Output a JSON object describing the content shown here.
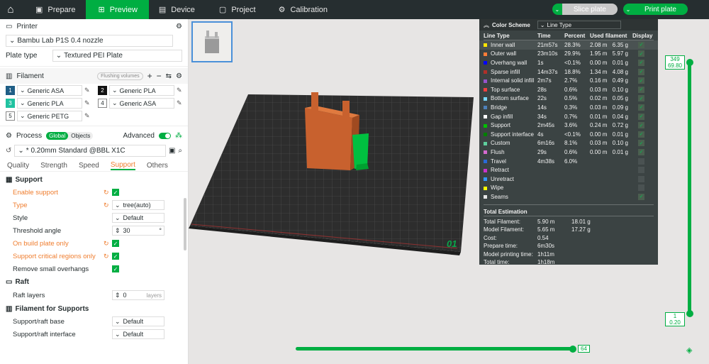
{
  "topbar": {
    "tabs": [
      {
        "label": "Prepare",
        "icon": "prepare-icon",
        "active": false
      },
      {
        "label": "Preview",
        "icon": "preview-icon",
        "active": true
      },
      {
        "label": "Device",
        "icon": "device-icon",
        "active": false
      },
      {
        "label": "Project",
        "icon": "project-icon",
        "active": false
      },
      {
        "label": "Calibration",
        "icon": "calibration-icon",
        "active": false
      }
    ],
    "slice_label": "Slice plate",
    "print_label": "Print plate"
  },
  "printer": {
    "section_title": "Printer",
    "printer_name": "Bambu Lab P1S 0.4 nozzle",
    "plate_type_label": "Plate type",
    "plate_type_value": "Textured PEI Plate"
  },
  "filament": {
    "section_title": "Filament",
    "flushing_label": "Flushing volumes",
    "items": [
      {
        "num": "1",
        "name": "Generic ASA",
        "color": "#1f5e86",
        "text": "#fff"
      },
      {
        "num": "2",
        "name": "Generic PLA",
        "color": "#111111",
        "text": "#fff"
      },
      {
        "num": "3",
        "name": "Generic PLA",
        "color": "#20c2a0",
        "text": "#fff"
      },
      {
        "num": "4",
        "name": "Generic ASA",
        "color": "#ffffff",
        "text": "#222"
      },
      {
        "num": "5",
        "name": "Generic PETG",
        "color": "#ffffff",
        "text": "#222"
      }
    ]
  },
  "process": {
    "section_title": "Process",
    "global_label": "Global",
    "objects_label": "Objects",
    "advanced_label": "Advanced",
    "preset": "* 0.20mm Standard @BBL X1C",
    "tabs": [
      "Quality",
      "Strength",
      "Speed",
      "Support",
      "Others"
    ],
    "active_tab": "Support"
  },
  "support": {
    "group_support": "Support",
    "enable_support": "Enable support",
    "type_label": "Type",
    "type_value": "tree(auto)",
    "style_label": "Style",
    "style_value": "Default",
    "threshold_label": "Threshold angle",
    "threshold_value": "30",
    "threshold_unit": "°",
    "build_plate_only": "On build plate only",
    "critical_regions": "Support critical regions only",
    "remove_small": "Remove small overhangs",
    "group_raft": "Raft",
    "raft_layers_label": "Raft layers",
    "raft_layers_value": "0",
    "raft_layers_unit": "layers",
    "group_filament": "Filament for Supports",
    "raft_base_label": "Support/raft base",
    "raft_base_value": "Default",
    "raft_interface_label": "Support/raft interface",
    "raft_interface_value": "Default"
  },
  "color_scheme": {
    "title": "Color Scheme",
    "mode": "Line Type",
    "columns": [
      "Line Type",
      "Time",
      "Percent",
      "Used filament",
      "Display"
    ],
    "rows": [
      {
        "name": "Inner wall",
        "color": "#ffe600",
        "time": "21m57s",
        "percent": "28.3%",
        "len": "2.08 m",
        "weight": "6.35 g",
        "display": true
      },
      {
        "name": "Outer wall",
        "color": "#ff7d38",
        "time": "23m10s",
        "percent": "29.9%",
        "len": "1.95 m",
        "weight": "5.97 g",
        "display": true
      },
      {
        "name": "Overhang wall",
        "color": "#0000ff",
        "time": "1s",
        "percent": "<0.1%",
        "len": "0.00 m",
        "weight": "0.01 g",
        "display": true
      },
      {
        "name": "Sparse infill",
        "color": "#b03029",
        "time": "14m37s",
        "percent": "18.8%",
        "len": "1.34 m",
        "weight": "4.08 g",
        "display": true
      },
      {
        "name": "Internal solid infill",
        "color": "#9654cc",
        "time": "2m7s",
        "percent": "2.7%",
        "len": "0.16 m",
        "weight": "0.49 g",
        "display": true
      },
      {
        "name": "Top surface",
        "color": "#f04040",
        "time": "28s",
        "percent": "0.6%",
        "len": "0.03 m",
        "weight": "0.10 g",
        "display": true
      },
      {
        "name": "Bottom surface",
        "color": "#7ad9ff",
        "time": "22s",
        "percent": "0.5%",
        "len": "0.02 m",
        "weight": "0.05 g",
        "display": true
      },
      {
        "name": "Bridge",
        "color": "#4d80ba",
        "time": "14s",
        "percent": "0.3%",
        "len": "0.03 m",
        "weight": "0.09 g",
        "display": true
      },
      {
        "name": "Gap infill",
        "color": "#ffffff",
        "time": "34s",
        "percent": "0.7%",
        "len": "0.01 m",
        "weight": "0.04 g",
        "display": true
      },
      {
        "name": "Support",
        "color": "#00c000",
        "time": "2m45s",
        "percent": "3.6%",
        "len": "0.24 m",
        "weight": "0.72 g",
        "display": true
      },
      {
        "name": "Support interface",
        "color": "#008000",
        "time": "4s",
        "percent": "<0.1%",
        "len": "0.00 m",
        "weight": "0.01 g",
        "display": true
      },
      {
        "name": "Custom",
        "color": "#5ed09e",
        "time": "6m16s",
        "percent": "8.1%",
        "len": "0.03 m",
        "weight": "0.10 g",
        "display": true
      },
      {
        "name": "Flush",
        "color": "#d56ad0",
        "time": "29s",
        "percent": "0.6%",
        "len": "0.00 m",
        "weight": "0.01 g",
        "display": true
      },
      {
        "name": "Travel",
        "color": "#2a6ad8",
        "time": "4m38s",
        "percent": "6.0%",
        "len": "",
        "weight": "",
        "display": false
      },
      {
        "name": "Retract",
        "color": "#cc33cc",
        "time": "",
        "percent": "",
        "len": "",
        "weight": "",
        "display": false
      },
      {
        "name": "Unretract",
        "color": "#3399ff",
        "time": "",
        "percent": "",
        "len": "",
        "weight": "",
        "display": false
      },
      {
        "name": "Wipe",
        "color": "#ffff00",
        "time": "",
        "percent": "",
        "len": "",
        "weight": "",
        "display": false
      },
      {
        "name": "Seams",
        "color": "#e6e6e6",
        "time": "",
        "percent": "",
        "len": "",
        "weight": "",
        "display": true
      }
    ],
    "estimation_title": "Total Estimation",
    "estimation": [
      {
        "label": "Total Filament:",
        "a": "5.90 m",
        "b": "18.01 g"
      },
      {
        "label": "Model Filament:",
        "a": "5.65 m",
        "b": "17.27 g"
      },
      {
        "label": "Cost:",
        "a": "0.54",
        "b": ""
      },
      {
        "label": "Prepare time:",
        "a": "6m30s",
        "b": ""
      },
      {
        "label": "Model printing time:",
        "a": "1h11m",
        "b": ""
      },
      {
        "label": "Total time:",
        "a": "1h18m",
        "b": ""
      }
    ]
  },
  "layer_slider": {
    "top_layer": "349",
    "top_height": "69.80",
    "bottom_layer": "1",
    "bottom_height": "0.20"
  },
  "move_slider": {
    "value": "64"
  },
  "plate_number": "01"
}
